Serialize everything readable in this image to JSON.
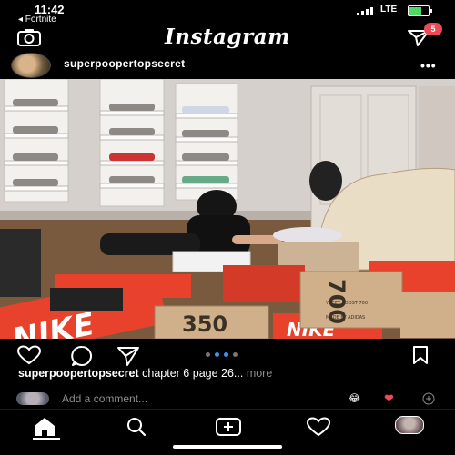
{
  "status_bar": {
    "time": "11:42",
    "back_app": "◂ Fortnite",
    "network": "LTE",
    "battery_color": "#4cd964"
  },
  "header": {
    "logo": "Instagram",
    "camera_icon": "camera-icon",
    "direct_icon": "paper-plane-icon",
    "direct_badge": "5",
    "badge_color": "#ed4956"
  },
  "post": {
    "username": "superpoopertopsecret",
    "more_icon": "•••",
    "carousel_dots": 4,
    "carousel_active": 2,
    "caption_username": "superpoopertopsecret",
    "caption_text": " chapter 6 page 26...",
    "caption_more": " more",
    "photo_box_labels": {
      "nike_1": "NIKE",
      "nike_2": "NIKE",
      "yeezy_1": "350",
      "yeezy_2": "700",
      "yeezy_text": "YEEZY BOOST 700",
      "yeezy_text_2": "MADE BY ADIDAS"
    }
  },
  "comment": {
    "placeholder": "Add a comment...",
    "emoji_laugh": "😂",
    "emoji_heart": "❤",
    "emoji_plus": "+"
  },
  "bottom_nav": {
    "items": [
      "home-icon",
      "search-icon",
      "add-post-icon",
      "activity-heart-icon",
      "profile-avatar"
    ]
  },
  "colors": {
    "accent_blue": "#3897f0",
    "nike_orange": "#e8412c"
  }
}
